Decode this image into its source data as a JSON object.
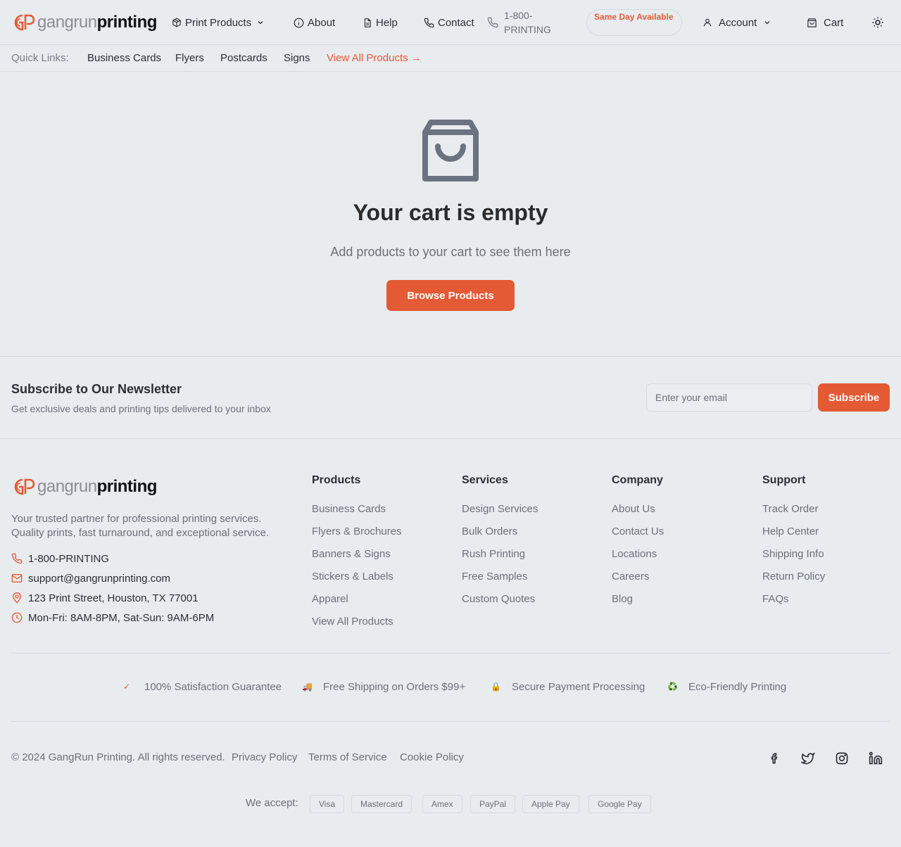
{
  "brand": {
    "name_light": "gangrun",
    "name_bold": "printing",
    "accent": "#e35a35"
  },
  "nav": {
    "print_products": "Print Products",
    "about": "About",
    "help": "Help",
    "contact": "Contact",
    "phone": "1-800-PRINTING",
    "badge": "Same Day Available",
    "account": "Account",
    "cart": "Cart"
  },
  "quick_links": {
    "label": "Quick Links:",
    "items": [
      "Business Cards",
      "Flyers",
      "Postcards",
      "Signs"
    ],
    "view_all": "View All Products →"
  },
  "cart": {
    "title": "Your cart is empty",
    "subtitle": "Add products to your cart to see them here",
    "button": "Browse Products"
  },
  "newsletter": {
    "title": "Subscribe to Our Newsletter",
    "subtitle": "Get exclusive deals and printing tips delivered to your inbox",
    "placeholder": "Enter your email",
    "button": "Subscribe"
  },
  "footer": {
    "description": "Your trusted partner for professional printing services. Quality prints, fast turnaround, and exceptional service.",
    "contact": {
      "phone": "1-800-PRINTING",
      "email": "support@gangrunprinting.com",
      "address": "123 Print Street, Houston, TX 77001",
      "hours": "Mon-Fri: 8AM-8PM, Sat-Sun: 9AM-6PM"
    },
    "columns": [
      {
        "title": "Products",
        "links": [
          "Business Cards",
          "Flyers & Brochures",
          "Banners & Signs",
          "Stickers & Labels",
          "Apparel",
          "View All Products"
        ]
      },
      {
        "title": "Services",
        "links": [
          "Design Services",
          "Bulk Orders",
          "Rush Printing",
          "Free Samples",
          "Custom Quotes"
        ]
      },
      {
        "title": "Company",
        "links": [
          "About Us",
          "Contact Us",
          "Locations",
          "Careers",
          "Blog"
        ]
      },
      {
        "title": "Support",
        "links": [
          "Track Order",
          "Help Center",
          "Shipping Info",
          "Return Policy",
          "FAQs"
        ]
      }
    ],
    "features": [
      {
        "icon": "✓",
        "label": "100% Satisfaction Guarantee"
      },
      {
        "icon": "🚚",
        "label": "Free Shipping on Orders $99+"
      },
      {
        "icon": "🔒",
        "label": "Secure Payment Processing"
      },
      {
        "icon": "♻️",
        "label": "Eco-Friendly Printing"
      }
    ],
    "copyright": "© 2024 GangRun Printing. All rights reserved.",
    "legal": [
      "Privacy Policy",
      "Terms of Service",
      "Cookie Policy"
    ],
    "social_icons": [
      "facebook-icon",
      "twitter-icon",
      "instagram-icon",
      "linkedin-icon"
    ],
    "accept_label": "We accept:",
    "payments": [
      "Visa",
      "Mastercard",
      "Amex",
      "PayPal",
      "Apple Pay",
      "Google Pay"
    ]
  }
}
